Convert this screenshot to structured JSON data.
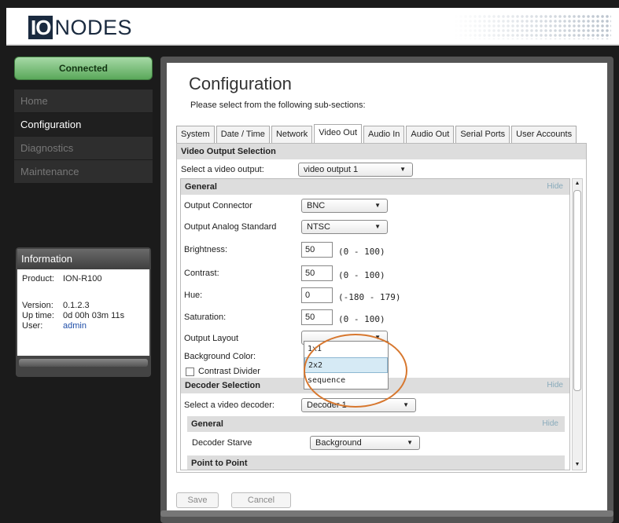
{
  "header": {
    "logo_box": "IO",
    "logo_text": "NODES"
  },
  "sidebar": {
    "status": "Connected",
    "nav": [
      "Home",
      "Configuration",
      "Diagnostics",
      "Maintenance"
    ]
  },
  "info": {
    "title": "Information",
    "product_label": "Product:",
    "product_value": "ION-R100",
    "version_label": "Version:",
    "version_value": "0.1.2.3",
    "uptime_label": "Up time:",
    "uptime_value": "0d 00h 03m 11s",
    "user_label": "User:",
    "user_value": "admin"
  },
  "main": {
    "title": "Configuration",
    "subtitle": "Please select from the following sub-sections:",
    "tabs": [
      "System",
      "Date / Time",
      "Network",
      "Video Out",
      "Audio In",
      "Audio Out",
      "Serial Ports",
      "User Accounts"
    ],
    "active_tab": "Video Out"
  },
  "video_output": {
    "heading": "Video Output Selection",
    "select_label": "Select a video output:",
    "select_value": "video output 1"
  },
  "general": {
    "heading": "General",
    "hide": "Hide",
    "output_connector_label": "Output Connector",
    "output_connector_value": "BNC",
    "analog_standard_label": "Output Analog Standard",
    "analog_standard_value": "NTSC",
    "brightness_label": "Brightness:",
    "brightness_value": "50",
    "brightness_range": "(0 - 100)",
    "contrast_label": "Contrast:",
    "contrast_value": "50",
    "contrast_range": "(0 - 100)",
    "hue_label": "Hue:",
    "hue_value": "0",
    "hue_range": "(-180 - 179)",
    "saturation_label": "Saturation:",
    "saturation_value": "50",
    "saturation_range": "(0 - 100)",
    "output_layout_label": "Output Layout",
    "output_layout_value": "",
    "layout_options": [
      "1x1",
      "2x2",
      "sequence"
    ],
    "background_color_label": "Background Color:",
    "contrast_divider_label": "Contrast Divider"
  },
  "decoder": {
    "heading": "Decoder Selection",
    "hide": "Hide",
    "select_label": "Select a video decoder:",
    "select_value": "Decoder 1",
    "general_heading": "General",
    "general_hide": "Hide",
    "starve_label": "Decoder Starve",
    "starve_value": "Background",
    "next_heading": "Point to Point"
  },
  "buttons": {
    "save": "Save",
    "cancel": "Cancel"
  }
}
